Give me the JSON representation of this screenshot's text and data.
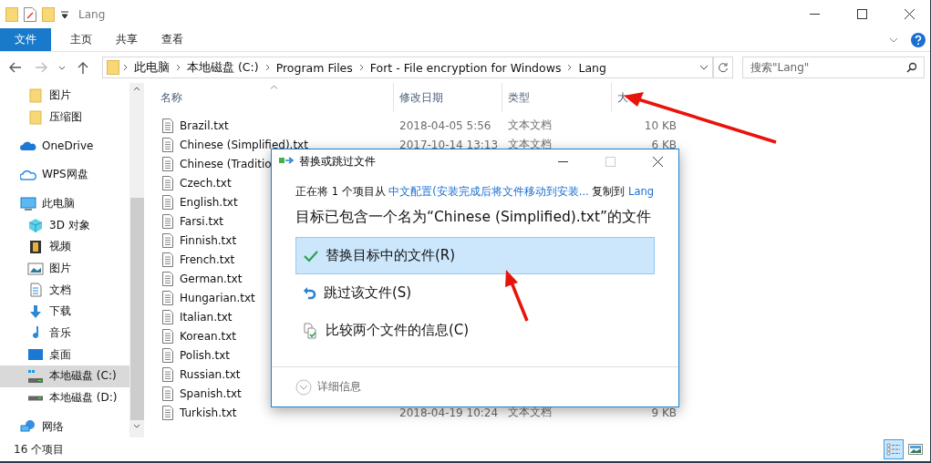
{
  "window": {
    "title": "Lang"
  },
  "ribbon": {
    "tabs": [
      {
        "label": "文件",
        "selected": true
      },
      {
        "label": "主页",
        "selected": false
      },
      {
        "label": "共享",
        "selected": false
      },
      {
        "label": "查看",
        "selected": false
      }
    ]
  },
  "address": {
    "crumbs": [
      "此电脑",
      "本地磁盘 (C:)",
      "Program Files",
      "Fort - File encryption for Windows",
      "Lang"
    ]
  },
  "search": {
    "placeholder": "搜索\"Lang\""
  },
  "sidebar": {
    "scrolled_items": [
      {
        "label": "图片"
      },
      {
        "label": "压缩图"
      }
    ],
    "items": [
      {
        "label": "OneDrive",
        "selected": false
      },
      {
        "label": "WPS网盘",
        "selected": false
      },
      {
        "label": "此电脑",
        "selected": false,
        "children": [
          {
            "label": "3D 对象",
            "selected": false
          },
          {
            "label": "视频",
            "selected": false
          },
          {
            "label": "图片",
            "selected": false
          },
          {
            "label": "文档",
            "selected": false
          },
          {
            "label": "下载",
            "selected": false
          },
          {
            "label": "音乐",
            "selected": false
          },
          {
            "label": "桌面",
            "selected": false
          },
          {
            "label": "本地磁盘 (C:)",
            "selected": true
          },
          {
            "label": "本地磁盘 (D:)",
            "selected": false
          }
        ]
      },
      {
        "label": "网络",
        "selected": false
      }
    ]
  },
  "table": {
    "columns": [
      "名称",
      "修改日期",
      "类型",
      "大"
    ],
    "rows": [
      {
        "name": "Brazil.txt",
        "date": "2018-04-05 5:56",
        "type": "文本文档",
        "size": "10 KB"
      },
      {
        "name": "Chinese (Simplified).txt",
        "date": "2017-10-14 13:13",
        "type": "文本文档",
        "size": "6 KB"
      },
      {
        "name": "Chinese (Traditio"
      },
      {
        "name": "Czech.txt"
      },
      {
        "name": "English.txt"
      },
      {
        "name": "Farsi.txt"
      },
      {
        "name": "Finnish.txt"
      },
      {
        "name": "French.txt"
      },
      {
        "name": "German.txt"
      },
      {
        "name": "Hungarian.txt"
      },
      {
        "name": "Italian.txt"
      },
      {
        "name": "Korean.txt"
      },
      {
        "name": "Polish.txt"
      },
      {
        "name": "Russian.txt"
      },
      {
        "name": "Spanish.txt"
      },
      {
        "name": "Turkish.txt",
        "date": "2018-04-19 10:24",
        "type": "文本文档",
        "size": "9 KB"
      }
    ]
  },
  "status_bar": {
    "count": "16 个项目",
    "views": [
      {
        "kind": "details",
        "selected": true
      },
      {
        "kind": "thumbnails",
        "selected": false
      }
    ]
  },
  "dialog": {
    "title": "替换或跳过文件",
    "progress": {
      "prefix": "正在将 1 个项目从",
      "source": "中文配置(安装完成后将文件移动到安装...",
      "middle": "复制到",
      "target": "Lang"
    },
    "heading": "目标已包含一个名为“Chinese (Simplified).txt”的文件",
    "options": [
      {
        "kind": "replace",
        "label": "替换目标中的文件(R)",
        "selected": true
      },
      {
        "kind": "skip",
        "label": "跳过该文件(S)",
        "selected": false
      },
      {
        "kind": "compare",
        "label": "比较两个文件的信息(C)",
        "selected": false
      }
    ],
    "details": "详细信息"
  }
}
